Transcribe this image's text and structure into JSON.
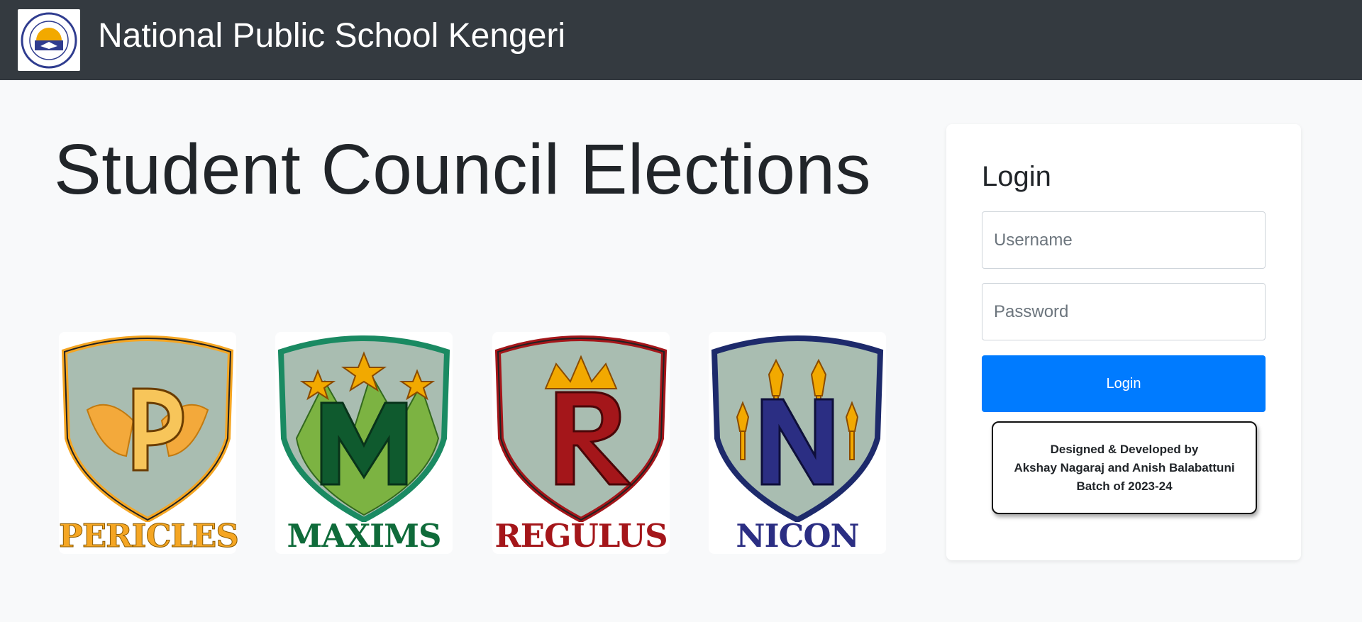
{
  "navbar": {
    "title": "National Public School Kengeri",
    "logo_icon": "school-emblem-icon"
  },
  "main": {
    "heading": "Student Council Elections"
  },
  "houses": [
    {
      "name": "PERICLES",
      "letter": "P",
      "color": "#f5a623",
      "border": "#f5a623"
    },
    {
      "name": "MAXIMS",
      "letter": "M",
      "color": "#0f6b3a",
      "border": "#1a8a62"
    },
    {
      "name": "REGULUS",
      "letter": "R",
      "color": "#a4161a",
      "border": "#a4161a"
    },
    {
      "name": "NICON",
      "letter": "N",
      "color": "#2b2e83",
      "border": "#1d2a6b"
    }
  ],
  "login": {
    "heading": "Login",
    "username_placeholder": "Username",
    "password_placeholder": "Password",
    "button_label": "Login",
    "button_color": "#007bff"
  },
  "credits": {
    "line1": "Designed & Developed by",
    "line2": "Akshay Nagaraj and Anish Balabattuni",
    "line3": "Batch of 2023-24"
  }
}
